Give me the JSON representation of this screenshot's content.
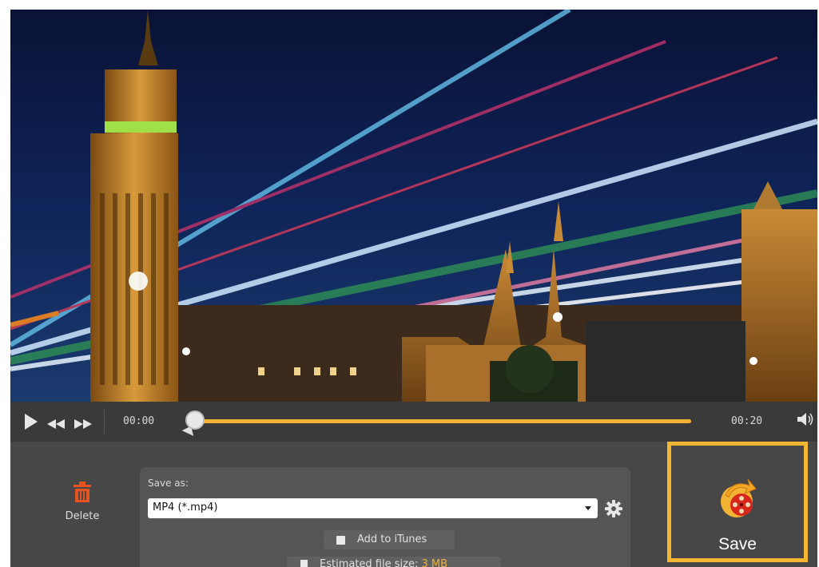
{
  "player": {
    "current_time": "00:00",
    "end_time": "00:20",
    "progress": 0.0
  },
  "export": {
    "delete_label": "Delete",
    "save_as_label": "Save as:",
    "format_value": "MP4 (*.mp4)",
    "add_to_itunes_label": "Add to iTunes",
    "estimated_size_label": "Estimated file size:",
    "estimated_size_value": "3 MB",
    "save_label": "Save"
  },
  "icons": {
    "play": "play-icon",
    "rewind": "rewind-icon",
    "forward": "fast-forward-icon",
    "volume": "volume-icon",
    "delete": "trash-icon",
    "settings": "gear-icon",
    "save": "save-film-icon"
  },
  "colors": {
    "accent": "#f2b233",
    "delete_icon": "#e8531f",
    "save_highlight": "#f5b731"
  }
}
